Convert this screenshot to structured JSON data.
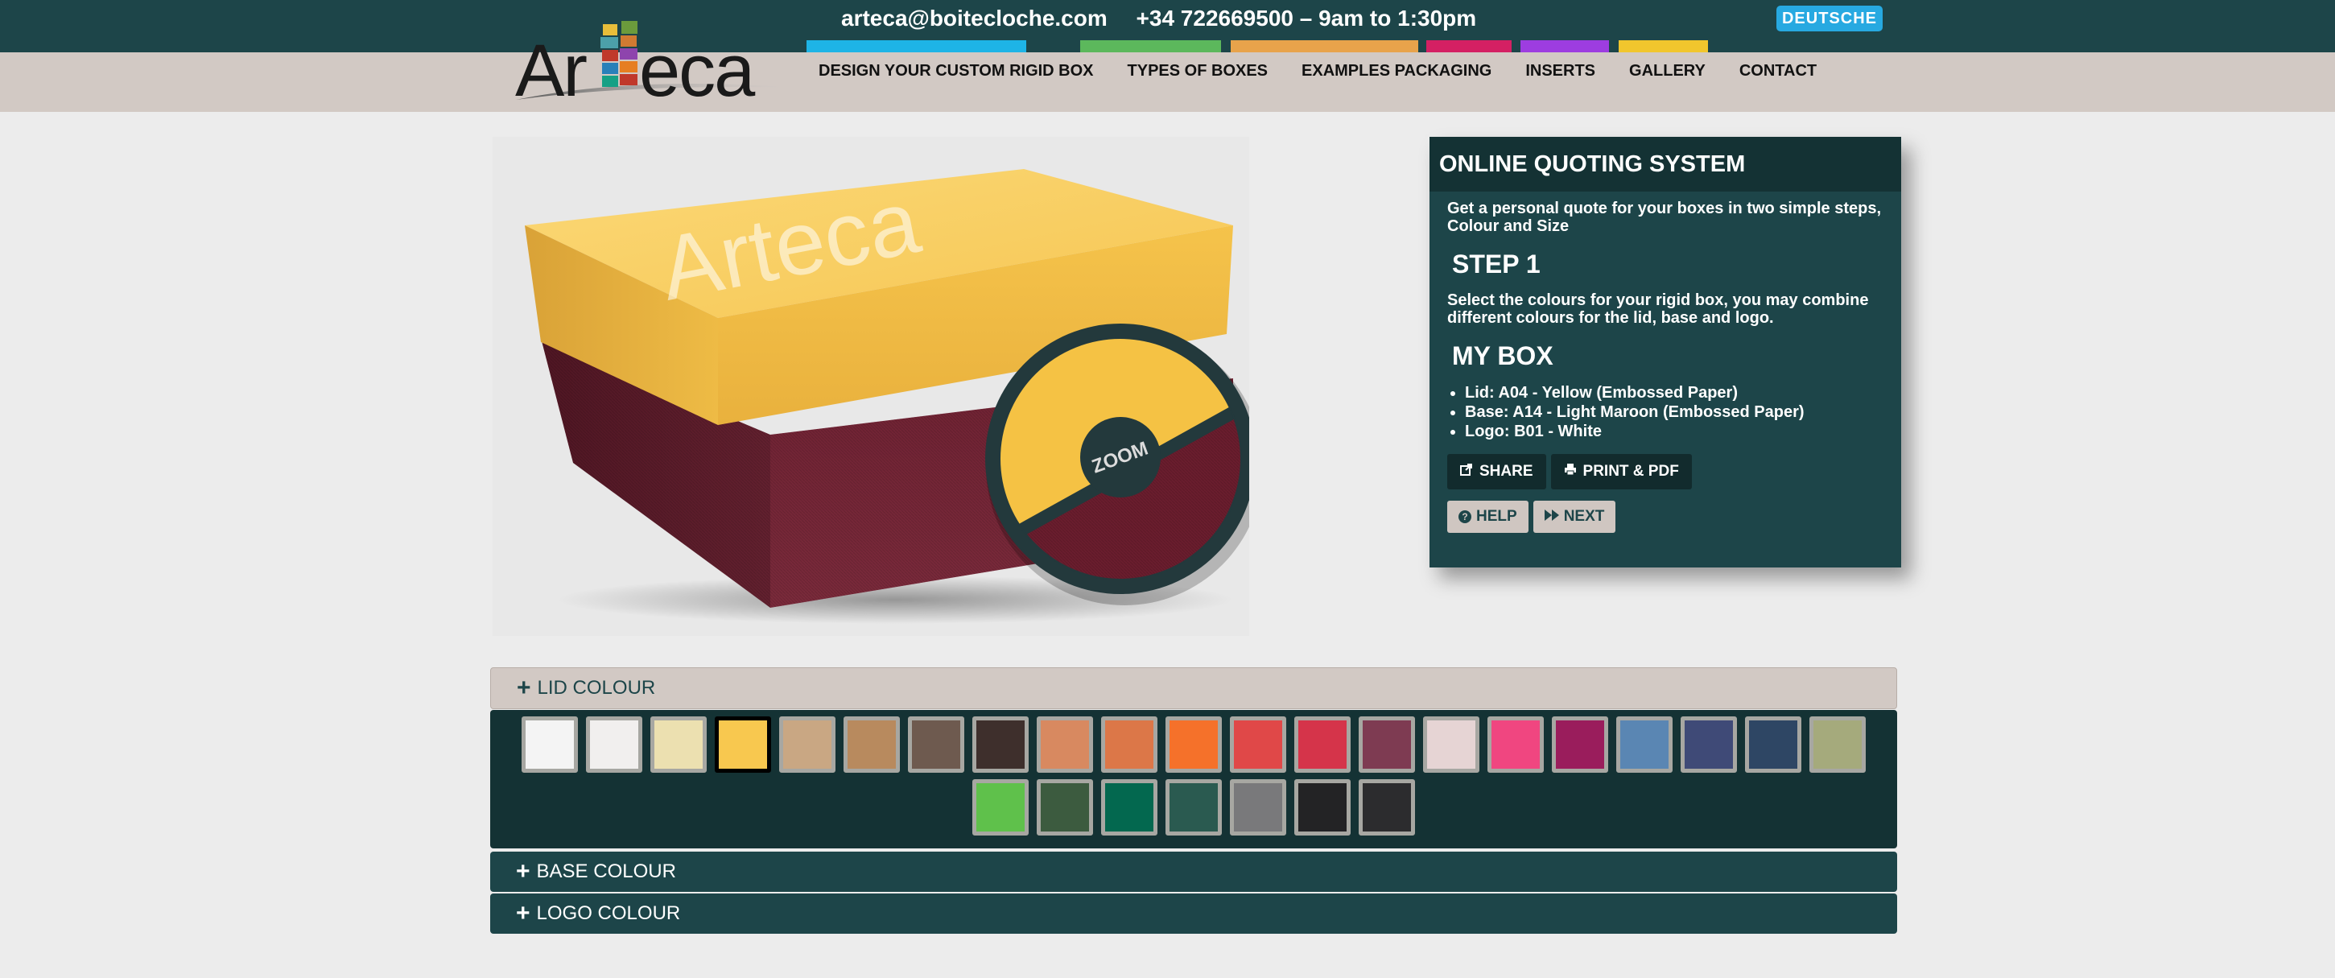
{
  "topbar": {
    "email": "arteca@boitecloche.com",
    "phone": "+34 722669500 – 9am to 1:30pm",
    "language_button": "DEUTSCHE",
    "strip_colors": [
      "#1eb4e6",
      "#5cb85c",
      "#e8a34b",
      "#d42063",
      "#9d3de0",
      "#f1c62d"
    ]
  },
  "logo": {
    "text": "Arteca"
  },
  "nav": {
    "items": [
      "DESIGN YOUR CUSTOM RIGID BOX",
      "TYPES OF BOXES",
      "EXAMPLES PACKAGING",
      "INSERTS",
      "GALLERY",
      "CONTACT"
    ]
  },
  "product": {
    "zoom_label": "ZOOM",
    "box_lettering": "Arteca",
    "lid_color": "#f8cd5c",
    "base_color": "#6a1d2e"
  },
  "quote": {
    "title": "ONLINE QUOTING SYSTEM",
    "intro": "Get a personal quote for your boxes in two simple steps, Colour and Size",
    "step_heading": "STEP 1",
    "step_text": "Select the colours for your rigid box, you may combine different colours for the lid, base and logo.",
    "mybox_heading": "MY BOX",
    "mybox_items": [
      "Lid: A04 - Yellow (Embossed Paper)",
      "Base: A14 - Light Maroon (Embossed Paper)",
      "Logo: B01 - White"
    ],
    "share_label": "SHARE",
    "print_label": "PRINT & PDF",
    "help_label": "HELP",
    "next_label": "NEXT"
  },
  "accordions": {
    "lid": "LID COLOUR",
    "base": "BASE COLOUR",
    "logo": "LOGO COLOUR"
  },
  "swatches": {
    "row1": [
      "#f4f4f4",
      "#f1efee",
      "#ece0b0",
      "#f8c84f",
      "#c9a783",
      "#b88a5e",
      "#6e5a4f",
      "#3e2f2c",
      "#d88960",
      "#dc7748",
      "#f5712a",
      "#e04848",
      "#d5344a",
      "#7e3b52",
      "#e6d4d4",
      "#f04680",
      "#9a1d5c",
      "#5a86b3",
      "#3f4a77",
      "#2e4664",
      "#a5aa7c"
    ],
    "row2": [
      "#5fc14b",
      "#3c5b3f",
      "#03684f",
      "#2a5a50",
      "#79797b",
      "#232325",
      "#2c2c2e"
    ],
    "selected": "#f8c84f"
  }
}
